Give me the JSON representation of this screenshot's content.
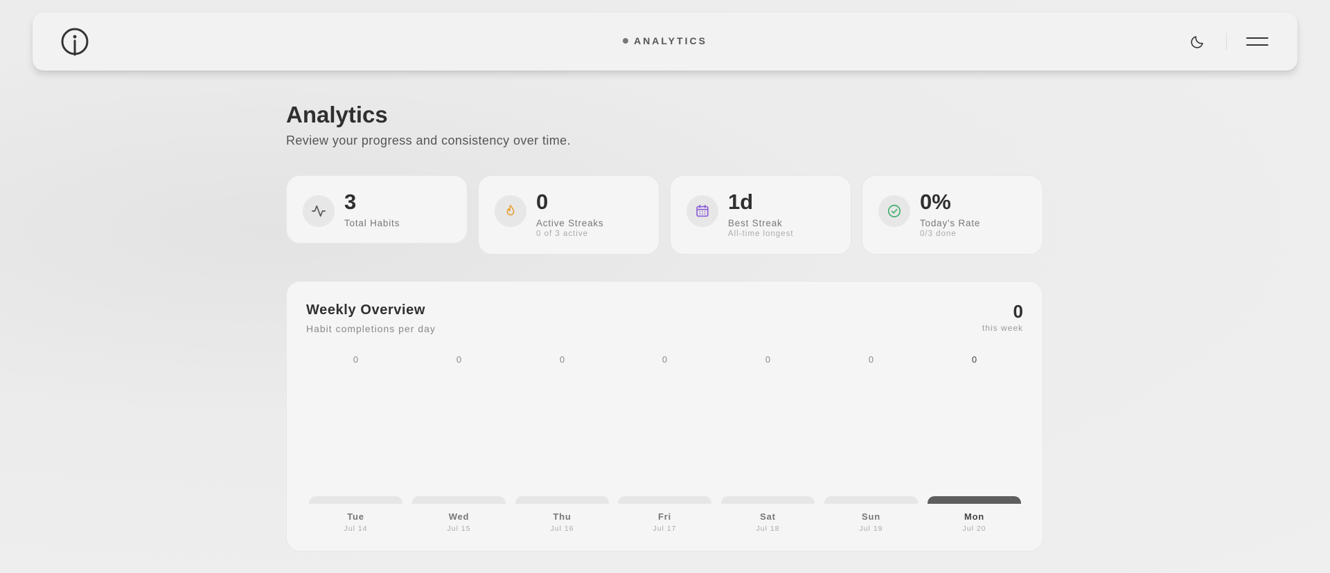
{
  "header": {
    "nav_label": "ANALYTICS"
  },
  "page": {
    "title": "Analytics",
    "subtitle": "Review your progress and consistency over time."
  },
  "stats": [
    {
      "value": "3",
      "label": "Total Habits",
      "sub": "",
      "icon": "activity-icon",
      "color": "#555555"
    },
    {
      "value": "0",
      "label": "Active Streaks",
      "sub": "0 of 3 active",
      "icon": "flame-icon",
      "color": "#e8a33a"
    },
    {
      "value": "1d",
      "label": "Best Streak",
      "sub": "All-time longest",
      "icon": "calendar-icon",
      "color": "#8a5bd6"
    },
    {
      "value": "0%",
      "label": "Today's Rate",
      "sub": "0/3 done",
      "icon": "check-circle-icon",
      "color": "#3fae6f"
    }
  ],
  "weekly": {
    "title": "Weekly Overview",
    "subtitle": "Habit completions per day",
    "total": "0",
    "total_label": "this week",
    "days": [
      {
        "name": "Tue",
        "date": "Jul 14",
        "count": "0",
        "today": false
      },
      {
        "name": "Wed",
        "date": "Jul 15",
        "count": "0",
        "today": false
      },
      {
        "name": "Thu",
        "date": "Jul 16",
        "count": "0",
        "today": false
      },
      {
        "name": "Fri",
        "date": "Jul 17",
        "count": "0",
        "today": false
      },
      {
        "name": "Sat",
        "date": "Jul 18",
        "count": "0",
        "today": false
      },
      {
        "name": "Sun",
        "date": "Jul 19",
        "count": "0",
        "today": false
      },
      {
        "name": "Mon",
        "date": "Jul 20",
        "count": "0",
        "today": true
      }
    ]
  }
}
